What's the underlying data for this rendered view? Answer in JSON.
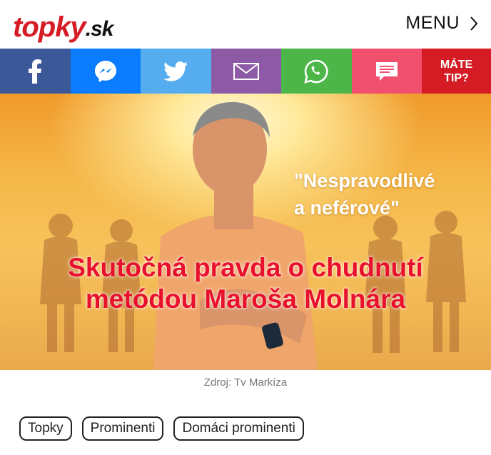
{
  "header": {
    "logo_brand": "topky",
    "logo_tld": ".sk",
    "menu_label": "MENU"
  },
  "share": {
    "buttons": [
      {
        "icon": "facebook-icon",
        "color": "#3b5998"
      },
      {
        "icon": "messenger-icon",
        "color": "#0a7cff"
      },
      {
        "icon": "twitter-icon",
        "color": "#55acee"
      },
      {
        "icon": "email-icon",
        "color": "#8d5aa6"
      },
      {
        "icon": "whatsapp-icon",
        "color": "#4cb748"
      },
      {
        "icon": "comments-icon",
        "color": "#f0506e"
      }
    ],
    "tip_line1": "MÁTE",
    "tip_line2": "TIP?",
    "tip_color": "#d51c24"
  },
  "hero": {
    "quote_line1": "\"Nespravodlivé",
    "quote_line2": "a neférové\"",
    "headline_line1": "Skutočná pravda o chudnutí",
    "headline_line2": "metódou Maroša Molnára"
  },
  "caption": "Zdroj: Tv Markíza",
  "tags": [
    "Topky",
    "Prominenti",
    "Domáci prominenti"
  ]
}
